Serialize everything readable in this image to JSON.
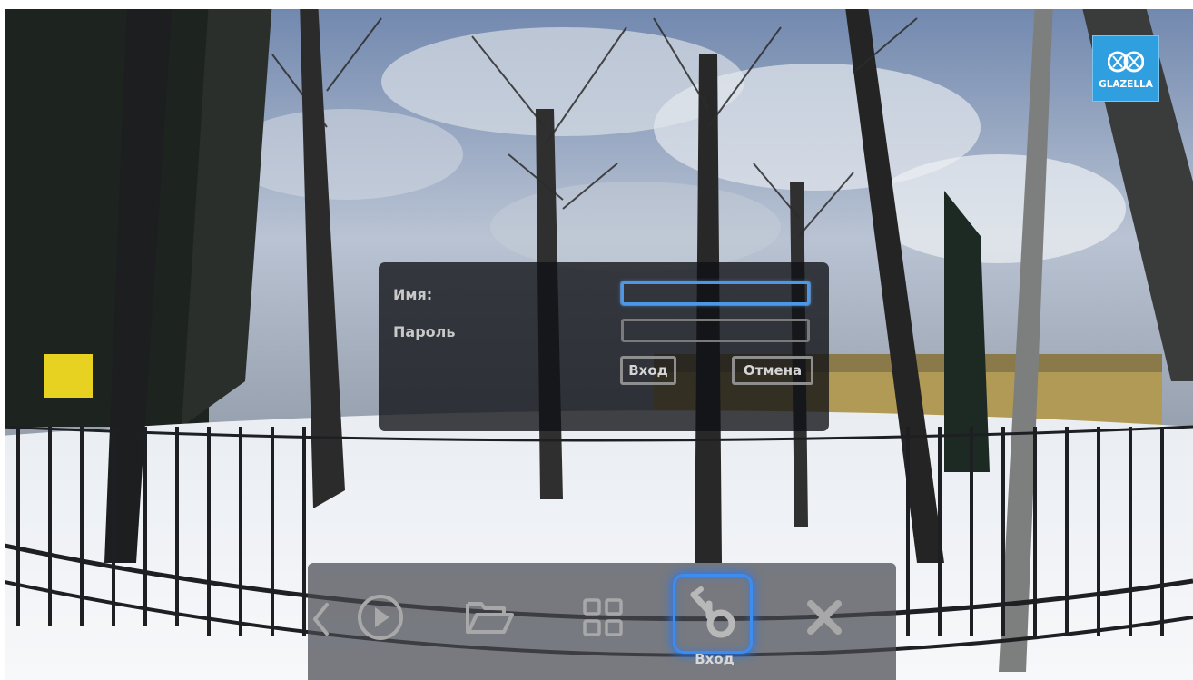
{
  "logo": {
    "text": "GLAZELLA",
    "icon": "glazella-logo-icon",
    "color": "#2f9fe0"
  },
  "login_dialog": {
    "name_label": "Имя:",
    "password_label": "Пароль",
    "name_value": "",
    "password_value": "",
    "login_button": "Вход",
    "cancel_button": "Отмена",
    "focus_color": "#4d98e6"
  },
  "toolbar": {
    "items": [
      {
        "icon": "chevron-left-icon"
      },
      {
        "icon": "play-icon"
      },
      {
        "icon": "folder-icon"
      },
      {
        "icon": "grid-icon"
      },
      {
        "icon": "login-key-icon",
        "label": "Вход",
        "selected": true
      },
      {
        "icon": "close-icon"
      }
    ],
    "selected_color": "#3d8cf0"
  }
}
